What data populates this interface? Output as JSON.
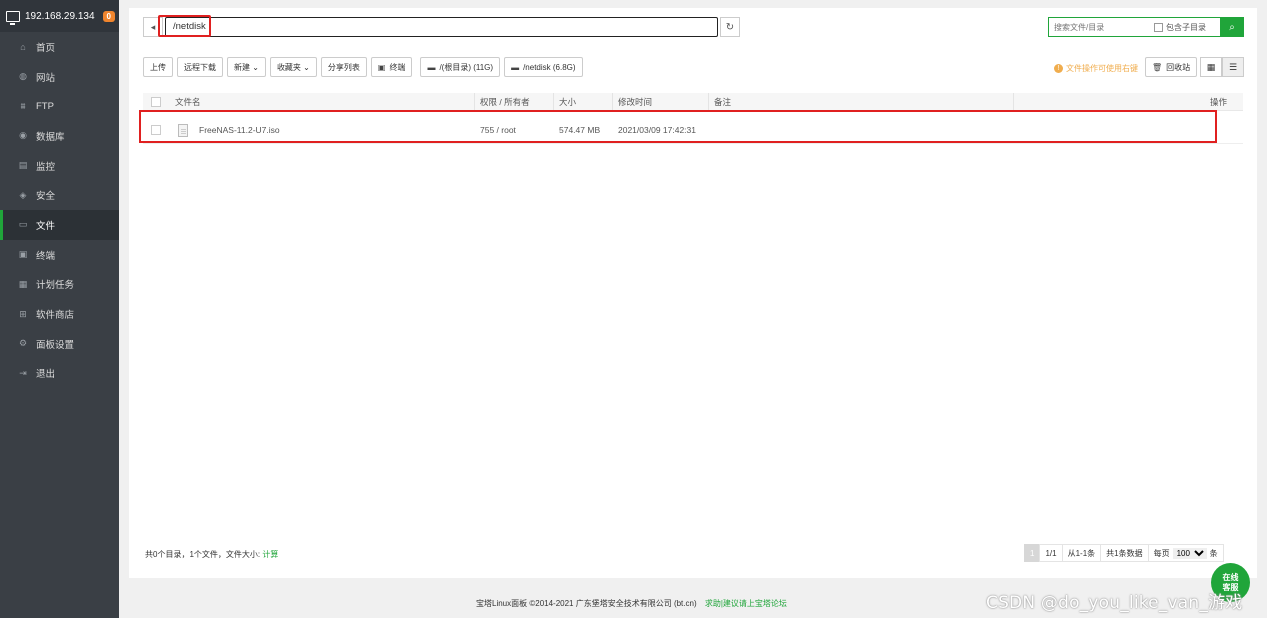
{
  "sidebar": {
    "server_ip": "192.168.29.134",
    "badge": "0",
    "items": [
      {
        "label": "首页",
        "icon": "home-icon",
        "glyph": "⌂"
      },
      {
        "label": "网站",
        "icon": "globe-icon",
        "glyph": "◍"
      },
      {
        "label": "FTP",
        "icon": "ftp-icon",
        "glyph": "⩩"
      },
      {
        "label": "数据库",
        "icon": "database-icon",
        "glyph": "◉"
      },
      {
        "label": "监控",
        "icon": "monitor-icon",
        "glyph": "▤"
      },
      {
        "label": "安全",
        "icon": "shield-icon",
        "glyph": "◈"
      },
      {
        "label": "文件",
        "icon": "folder-icon",
        "glyph": "▭"
      },
      {
        "label": "终端",
        "icon": "terminal-icon",
        "glyph": "▣"
      },
      {
        "label": "计划任务",
        "icon": "calendar-icon",
        "glyph": "▦"
      },
      {
        "label": "软件商店",
        "icon": "grid-icon",
        "glyph": "⊞"
      },
      {
        "label": "面板设置",
        "icon": "gear-icon",
        "glyph": "⚙"
      },
      {
        "label": "退出",
        "icon": "logout-icon",
        "glyph": "⇥"
      }
    ],
    "active_index": 6
  },
  "path": {
    "value": "/netdisk"
  },
  "search": {
    "placeholder": "搜索文件/目录",
    "include_sub_label": "包含子目录"
  },
  "toolbar": {
    "upload": "上传",
    "remote_download": "远程下载",
    "new": "新建",
    "favorites": "收藏夹",
    "share_list": "分享列表",
    "terminal": "终端",
    "disk_root": "/(根目录) (11G)",
    "disk_netdisk": "/netdisk (6.8G)"
  },
  "tip": "文件操作可使用右键",
  "recycle": "回收站",
  "table": {
    "headers": {
      "name": "文件名",
      "perm": "权限 / 所有者",
      "size": "大小",
      "mtime": "修改时间",
      "note": "备注",
      "ops": "操作"
    },
    "rows": [
      {
        "name": "FreeNAS-11.2-U7.iso",
        "perm": "755 / root",
        "size": "574.47 MB",
        "mtime": "2021/03/09 17:42:31",
        "note": ""
      }
    ]
  },
  "summary": {
    "text": "共0个目录，1个文件，文件大小:",
    "calc": "计算"
  },
  "pager": {
    "current": "1",
    "pages": "1/1",
    "range": "从1-1条",
    "total": "共1条数据",
    "per_page_label": "每页",
    "per_page": "100",
    "unit": "条"
  },
  "footer": {
    "copyright": "宝塔Linux面板 ©2014-2021 广东堡塔安全技术有限公司 (bt.cn)",
    "link": "求助|建议请上宝塔论坛"
  },
  "online_service": {
    "line1": "在线",
    "line2": "客服"
  },
  "watermark": "CSDN @do_you_like_van_游戏",
  "colors": {
    "brand_green": "#20a53a",
    "highlight_red": "#e02020",
    "sidebar_bg": "#3a3f45"
  }
}
